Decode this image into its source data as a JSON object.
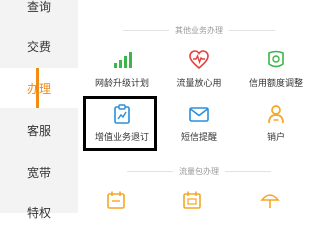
{
  "sidebar": {
    "items": [
      {
        "label": "查询"
      },
      {
        "label": "交费"
      },
      {
        "label": "办理"
      },
      {
        "label": "客服"
      },
      {
        "label": "宽带"
      },
      {
        "label": "特权"
      }
    ]
  },
  "main": {
    "section1_title": "其他业务办理",
    "items": [
      {
        "label": "网龄升级计划",
        "icon": "signal-bars-icon"
      },
      {
        "label": "流量放心用",
        "icon": "heart-heartbeat-icon"
      },
      {
        "label": "信用额度调整",
        "icon": "credit-badge-icon"
      },
      {
        "label": "增值业务退订",
        "icon": "clipboard-chart-icon"
      },
      {
        "label": "短信提醒",
        "icon": "envelope-icon"
      },
      {
        "label": "销户",
        "icon": "person-remove-icon"
      }
    ],
    "section2_title": "流量包办理",
    "bottom_icons": [
      "calendar-icon",
      "calendar-icon",
      "umbrella-icon"
    ]
  },
  "colors": {
    "accent": "#f28b12",
    "icon_orange": "#f5a623",
    "icon_green": "#3cb54a",
    "icon_red": "#e8413c",
    "icon_blue": "#2a8fdc",
    "selection_border": "#000000"
  }
}
